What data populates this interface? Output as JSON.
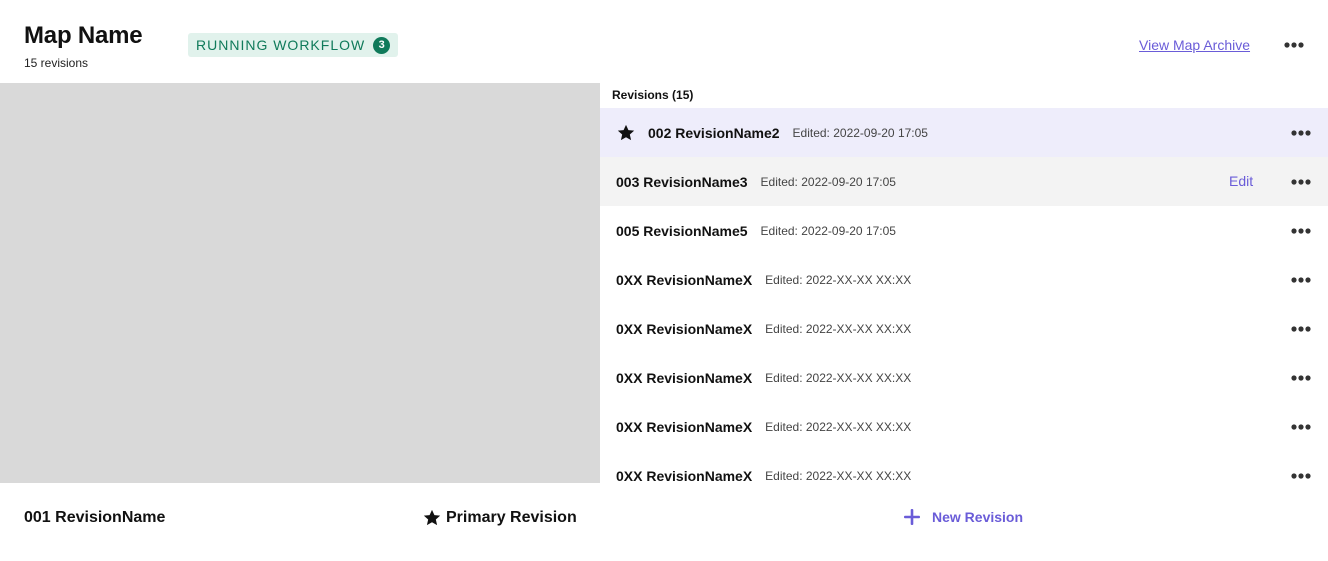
{
  "header": {
    "title": "Map Name",
    "subtitle": "15 revisions",
    "workflow_label": "RUNNING WORKFLOW",
    "workflow_count": "3",
    "archive_link": "View Map Archive",
    "more_icon": "more-horizontal-icon"
  },
  "revisions": {
    "heading": "Revisions (15)",
    "items": [
      {
        "name": "002 RevisionName2",
        "edited": "Edited: 2022-09-20 17:05",
        "starred": true,
        "state": "selected"
      },
      {
        "name": "003 RevisionName3",
        "edited": "Edited: 2022-09-20 17:05",
        "starred": false,
        "state": "hovered",
        "edit_label": "Edit"
      },
      {
        "name": "005 RevisionName5",
        "edited": "Edited: 2022-09-20 17:05",
        "starred": false,
        "state": "normal"
      },
      {
        "name": "0XX RevisionNameX",
        "edited": "Edited: 2022-XX-XX XX:XX",
        "starred": false,
        "state": "normal"
      },
      {
        "name": "0XX RevisionNameX",
        "edited": "Edited: 2022-XX-XX XX:XX",
        "starred": false,
        "state": "normal"
      },
      {
        "name": "0XX RevisionNameX",
        "edited": "Edited: 2022-XX-XX XX:XX",
        "starred": false,
        "state": "normal"
      },
      {
        "name": "0XX RevisionNameX",
        "edited": "Edited: 2022-XX-XX XX:XX",
        "starred": false,
        "state": "normal"
      },
      {
        "name": "0XX RevisionNameX",
        "edited": "Edited: 2022-XX-XX XX:XX",
        "starred": false,
        "state": "normal"
      }
    ]
  },
  "footer": {
    "revision_name": "001 RevisionName",
    "primary_label": "Primary Revision",
    "primary_icon": "star-icon",
    "new_revision_label": "New Revision",
    "new_revision_icon": "plus-icon"
  },
  "colors": {
    "accent": "#6a5cd8",
    "workflow_bg": "#e1f2ec",
    "workflow_fg": "#0f7a5a",
    "selected_row_bg": "#eeedfb",
    "hover_row_bg": "#f3f3f3",
    "preview_bg": "#d9d9d9"
  }
}
